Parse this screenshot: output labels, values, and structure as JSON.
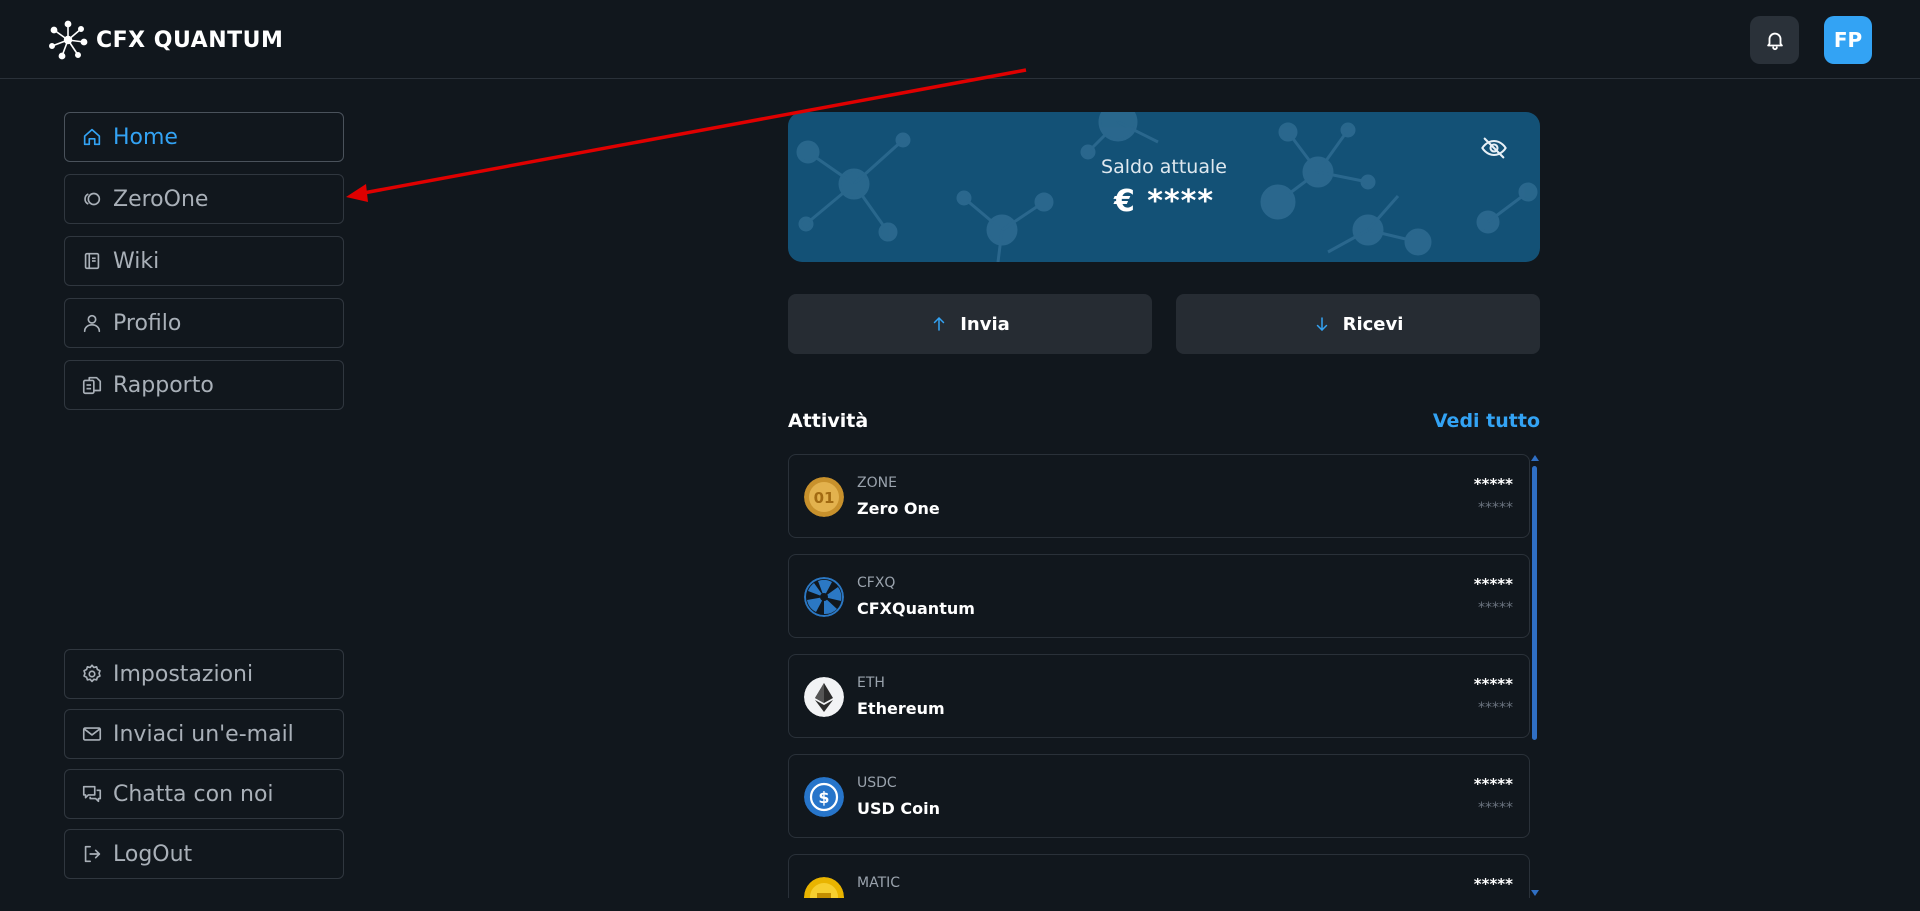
{
  "header": {
    "brand_name": "CFX QUANTUM",
    "brand_logo_icon": "molecule-logo-icon",
    "notifications_icon": "bell-icon",
    "avatar_initials": "FP",
    "avatar_color": "#33a3f4"
  },
  "sidebar": {
    "top_items": [
      {
        "label": "Home",
        "icon": "home-icon",
        "active": true
      },
      {
        "label": "ZeroOne",
        "icon": "zeroone-icon",
        "active": false
      },
      {
        "label": "Wiki",
        "icon": "book-icon",
        "active": false
      },
      {
        "label": "Profilo",
        "icon": "user-icon",
        "active": false
      },
      {
        "label": "Rapporto",
        "icon": "report-icon",
        "active": false
      }
    ],
    "bottom_items": [
      {
        "label": "Impostazioni",
        "icon": "gear-icon"
      },
      {
        "label": "Inviaci un'e-mail",
        "icon": "mail-icon"
      },
      {
        "label": "Chatta con noi",
        "icon": "chat-icon"
      },
      {
        "label": "LogOut",
        "icon": "logout-icon"
      }
    ]
  },
  "balance": {
    "label": "Saldo attuale",
    "value": "€ ****",
    "hide_icon": "eye-off-icon",
    "card_color": "#135176"
  },
  "actions": {
    "send_label": "Invia",
    "send_icon": "arrow-up-icon",
    "receive_label": "Ricevi",
    "receive_icon": "arrow-down-icon"
  },
  "activity": {
    "title": "Attività",
    "see_all": "Vedi tutto",
    "assets": [
      {
        "symbol": "ZONE",
        "name": "Zero One",
        "amount": "*****",
        "fiat": "*****",
        "icon": "zero-one-coin-icon"
      },
      {
        "symbol": "CFXQ",
        "name": "CFXQuantum",
        "amount": "*****",
        "fiat": "*****",
        "icon": "cfxquantum-coin-icon"
      },
      {
        "symbol": "ETH",
        "name": "Ethereum",
        "amount": "*****",
        "fiat": "*****",
        "icon": "ethereum-coin-icon"
      },
      {
        "symbol": "USDC",
        "name": "USD Coin",
        "amount": "*****",
        "fiat": "*****",
        "icon": "usd-coin-icon"
      },
      {
        "symbol": "MATIC",
        "name": "",
        "amount": "*****",
        "fiat": "",
        "icon": "matic-coin-icon"
      }
    ]
  },
  "colors": {
    "background": "#11171d",
    "accent": "#33a3f4",
    "annotation_arrow": "#e00000"
  }
}
